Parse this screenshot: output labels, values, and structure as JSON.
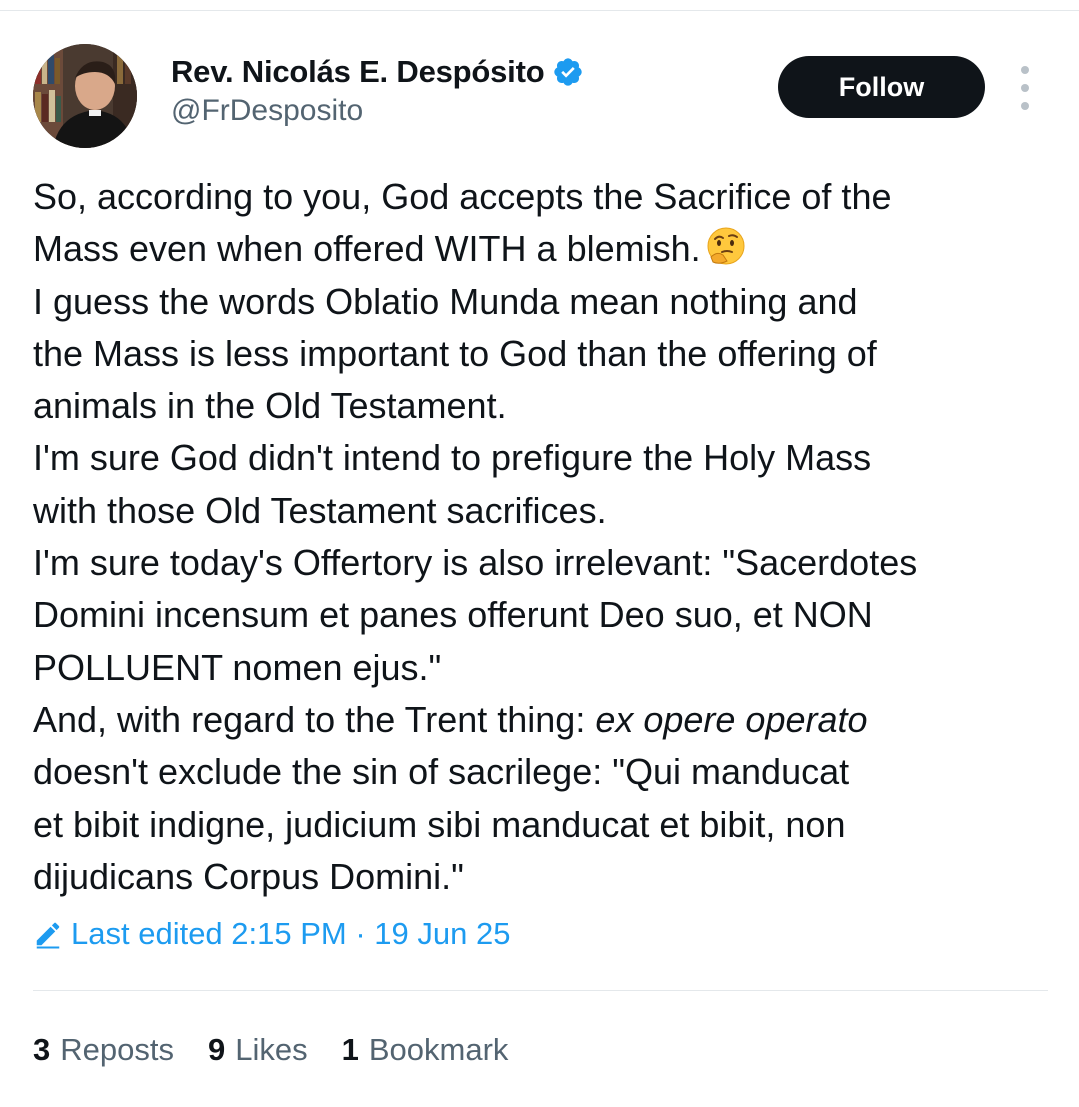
{
  "author": {
    "display_name": "Rev. Nicolás E. Despósito",
    "handle": "@FrDesposito",
    "verified_icon": "verified-badge-icon",
    "avatar": "profile-photo"
  },
  "actions": {
    "follow_label": "Follow",
    "more_icon": "more-vertical-icon"
  },
  "tweet": {
    "lines": [
      {
        "text": "So, according to you, God accepts the Sacrifice of the"
      },
      {
        "text": "Mass even when offered WITH a blemish.",
        "emoji": "thinking-face-emoji"
      },
      {
        "text": "I guess the words Oblatio Munda mean nothing and"
      },
      {
        "text": "the Mass is less important to God than the offering of"
      },
      {
        "text": "animals in the Old Testament."
      },
      {
        "text": "I'm sure God didn't intend to prefigure the Holy Mass"
      },
      {
        "text": "with those Old Testament sacrifices."
      },
      {
        "text": "I'm sure today's Offertory is also irrelevant: \"Sacerdotes"
      },
      {
        "text": "Domini incensum et panes offerunt Deo suo, et NON"
      },
      {
        "text": "POLLUENT nomen ejus.\""
      },
      {
        "prefix": "And, with regard to the Trent thing: ",
        "italic": "ex opere operato"
      },
      {
        "text": "doesn't exclude the sin of sacrilege: \"Qui manducat"
      },
      {
        "text": "et bibit indigne, judicium sibi manducat et bibit, non"
      },
      {
        "text": "dijudicans Corpus Domini.\""
      }
    ]
  },
  "edited": {
    "icon": "pencil-icon",
    "label": "Last edited 2:15 PM · 19 Jun 25"
  },
  "stats": {
    "reposts_count": "3",
    "reposts_label": "Reposts",
    "likes_count": "9",
    "likes_label": "Likes",
    "bookmarks_count": "1",
    "bookmarks_label": "Bookmark"
  },
  "colors": {
    "text": "#0f1419",
    "secondary": "#536471",
    "link": "#1d9bf0",
    "verified": "#1d9bf0",
    "button_bg": "#0f1419"
  }
}
